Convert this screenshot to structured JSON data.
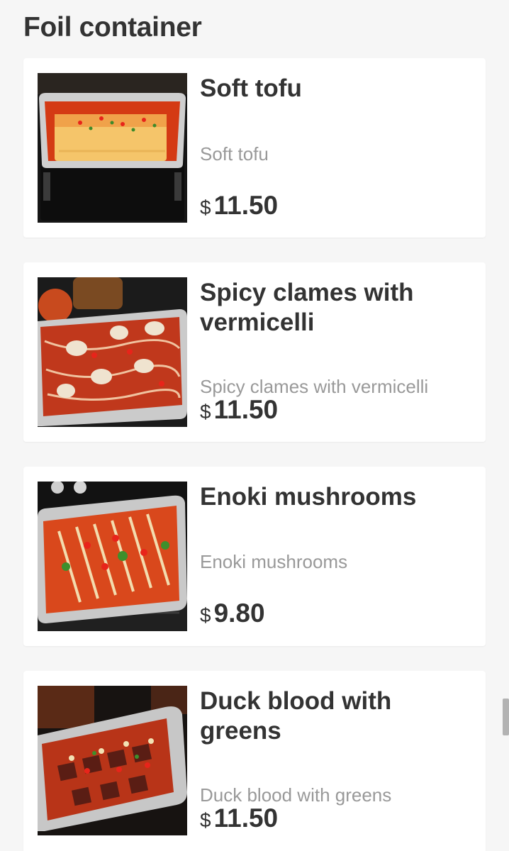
{
  "section": {
    "title": "Foil container"
  },
  "currency_symbol": "$",
  "items": [
    {
      "name": "Soft tofu",
      "description": "Soft tofu",
      "price": "11.50",
      "image_icon": "soft-tofu-photo"
    },
    {
      "name": "Spicy clames with vermicelli",
      "description": "Spicy clames with vermicelli",
      "price": "11.50",
      "image_icon": "spicy-clams-photo"
    },
    {
      "name": "Enoki mushrooms",
      "description": "Enoki mushrooms",
      "price": "9.80",
      "image_icon": "enoki-mushrooms-photo"
    },
    {
      "name": "Duck blood with greens",
      "description": "Duck blood with greens",
      "price": "11.50",
      "image_icon": "duck-blood-photo"
    }
  ],
  "colors": {
    "background": "#f6f6f6",
    "card": "#ffffff",
    "title_text": "#333333",
    "description_text": "#999999",
    "foil": "#c9c9c9",
    "sauce": "#c8401f"
  }
}
